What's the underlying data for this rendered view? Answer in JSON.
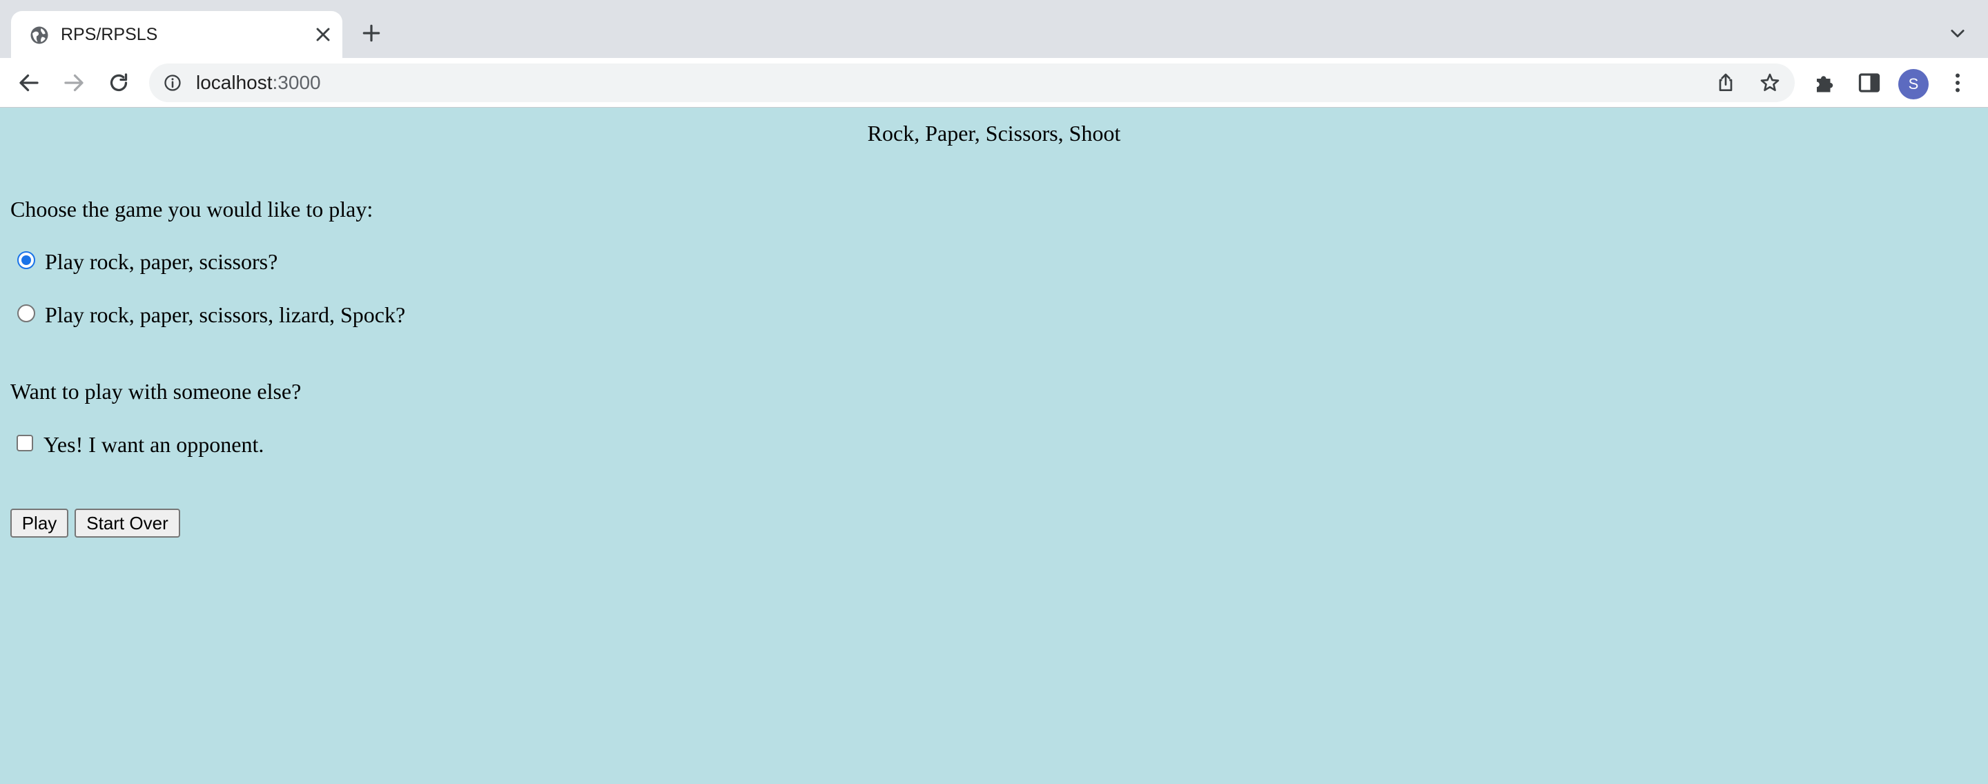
{
  "browser": {
    "tab": {
      "title": "RPS/RPSLS",
      "favicon": "globe-icon"
    },
    "url": {
      "host": "localhost",
      "port": ":3000"
    },
    "avatar_initial": "S",
    "colors": {
      "chrome": "#dee1e6",
      "avatar": "#5c6bc0",
      "page_bg": "#b9dfe4"
    }
  },
  "page": {
    "title": "Rock, Paper, Scissors, Shoot",
    "game_prompt": "Choose the game you would like to play:",
    "game_options": [
      {
        "label": "Play rock, paper, scissors?",
        "checked": true
      },
      {
        "label": "Play rock, paper, scissors, lizard, Spock?",
        "checked": false
      }
    ],
    "opponent_prompt": "Want to play with someone else?",
    "opponent_option": {
      "label": "Yes! I want an opponent.",
      "checked": false
    },
    "buttons": {
      "play": "Play",
      "start_over": "Start Over"
    }
  }
}
